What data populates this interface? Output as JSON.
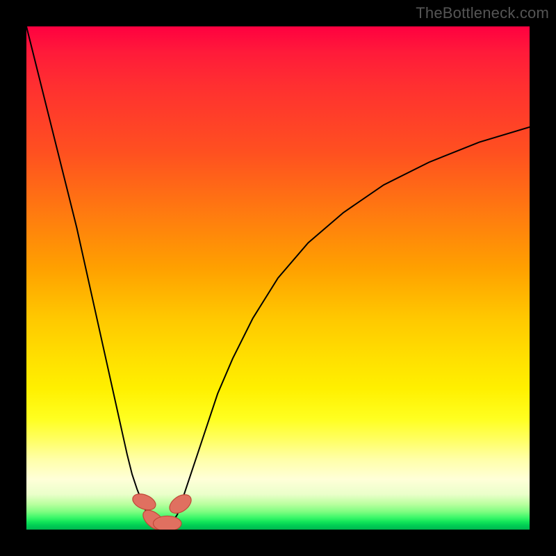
{
  "watermark": "TheBottleneck.com",
  "chart_data": {
    "type": "line",
    "title": "",
    "xlabel": "",
    "ylabel": "",
    "xlim": [
      0,
      100
    ],
    "ylim": [
      0,
      100
    ],
    "grid": false,
    "legend": false,
    "series": [
      {
        "name": "left-branch",
        "x": [
          0,
          2,
          4,
          6,
          8,
          10,
          12,
          14,
          16,
          18,
          20,
          21,
          22,
          23,
          24,
          25
        ],
        "y": [
          100,
          92,
          84,
          76,
          68,
          60,
          51,
          42,
          33,
          24,
          15,
          11,
          8,
          5.5,
          3,
          1.5
        ],
        "stroke": "#000000",
        "stroke_width": 2.0
      },
      {
        "name": "right-branch",
        "x": [
          29,
          30,
          31,
          32,
          34,
          36,
          38,
          41,
          45,
          50,
          56,
          63,
          71,
          80,
          90,
          100
        ],
        "y": [
          1.5,
          3.0,
          6.0,
          9.0,
          15,
          21,
          27,
          34,
          42,
          50,
          57,
          63,
          68.5,
          73,
          77,
          80
        ],
        "stroke": "#000000",
        "stroke_width": 2.0
      }
    ],
    "markers": [
      {
        "shape": "capsule",
        "cx": 23.4,
        "cy": 5.5,
        "rx": 1.4,
        "ry": 2.4,
        "angle": -68,
        "fill": "#e07060",
        "stroke": "#c04838"
      },
      {
        "shape": "capsule",
        "cx": 25.3,
        "cy": 1.9,
        "rx": 1.4,
        "ry": 2.5,
        "angle": -50,
        "fill": "#e07060",
        "stroke": "#c04838"
      },
      {
        "shape": "capsule",
        "cx": 28.0,
        "cy": 1.2,
        "rx": 2.8,
        "ry": 1.5,
        "angle": 0,
        "fill": "#e07060",
        "stroke": "#c04838"
      },
      {
        "shape": "capsule",
        "cx": 30.6,
        "cy": 5.1,
        "rx": 1.5,
        "ry": 2.4,
        "angle": 55,
        "fill": "#e07060",
        "stroke": "#c04838"
      }
    ],
    "background_gradient": {
      "direction": "vertical",
      "stops": [
        {
          "pos": 0.0,
          "color": "#ff0040"
        },
        {
          "pos": 0.48,
          "color": "#ffa000"
        },
        {
          "pos": 0.82,
          "color": "#ffff60"
        },
        {
          "pos": 1.0,
          "color": "#00b74f"
        }
      ]
    }
  }
}
